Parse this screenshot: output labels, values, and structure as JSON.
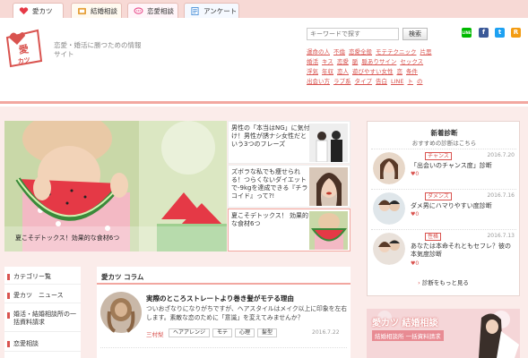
{
  "nav": {
    "tabs": [
      {
        "label": "愛カツ",
        "icon": "heart-icon",
        "color": "#e63946"
      },
      {
        "label": "結婚相談",
        "icon": "ring-icon",
        "color": "#e6a23c"
      },
      {
        "label": "恋愛相談",
        "icon": "chat-icon",
        "color": "#e84a8a"
      },
      {
        "label": "アンケート",
        "icon": "survey-icon",
        "color": "#4a90d9"
      }
    ]
  },
  "header": {
    "logo_text": "愛カツ",
    "tagline_line1": "恋愛・婚活に勝つための情報",
    "tagline_line2": "サイト",
    "search_placeholder": "キーワードで探す",
    "search_button": "検索",
    "tags": [
      "運命の人",
      "不倫",
      "恋愛全般",
      "モテテクニック",
      "片思",
      "婚活",
      "キス",
      "恋愛",
      "脈",
      "脈ありサイン",
      "セックス",
      "浮気",
      "年収",
      "恋人",
      "遊びやすい女性",
      "恋",
      "条件",
      "出会い方",
      "ラブ系",
      "タイプ",
      "告白",
      "LINE",
      "ト",
      "の"
    ],
    "social": [
      {
        "name": "line-icon",
        "label": "LINE",
        "color": "#00b900"
      },
      {
        "name": "facebook-icon",
        "label": "f",
        "color": "#3b5998"
      },
      {
        "name": "twitter-icon",
        "label": "t",
        "color": "#1da1f2"
      },
      {
        "name": "rss-icon",
        "label": "R",
        "color": "#f39c12"
      }
    ]
  },
  "hero": {
    "caption": "夏こそデトックス！効果的な食材6つ"
  },
  "side_articles": [
    {
      "text": "男性の「本当はNG」に気付け！男性が誘ナシ女性だという3つのフレーズ"
    },
    {
      "text": "ズボラな私でも痩せられる！つらくないダイエットで-9kgを達成できる『チラコイド』って?!"
    },
    {
      "text": "夏こそデトックス！ 効果的な食材6つ"
    }
  ],
  "ranking": {
    "title": "新着診断",
    "subtitle": "おすすめの診断はこちら",
    "items": [
      {
        "category": "チャンス",
        "date": "2016.7.20",
        "title": "「出会いのチャンス度」診断",
        "likes": "♥0"
      },
      {
        "category": "ダメンズ",
        "date": "2016.7.16",
        "title": "ダメ男にハマりやすい度診断",
        "likes": "♥0"
      },
      {
        "category": "性格",
        "date": "2016.7.13",
        "title": "あなたは本命それともセフレ？彼の本気度診断",
        "likes": "♥0"
      }
    ],
    "more": "診断をもっと見る"
  },
  "categories": {
    "items": [
      "カテゴリー覧",
      "愛カツ　ニュース",
      "婚活・結婚相談所の一括資料請求",
      "恋愛相談"
    ]
  },
  "column": {
    "header": "愛カツ コラム",
    "article_title": "実際のところストレートより巻き髪がモテる理由",
    "article_body": "ついおざなりになりがちですが、ヘアスタイルはメイク以上に印象を左右します。素敵な恋のために「意識」を変えてみませんか？",
    "author": "三村梨",
    "tags": [
      "ヘアアレンジ",
      "モテ",
      "心理",
      "髪型"
    ],
    "date": "2016.7.22"
  },
  "banner": {
    "title": "愛カツ 結婚相談",
    "subtitle": "結婚相談所 一括資料請求"
  }
}
